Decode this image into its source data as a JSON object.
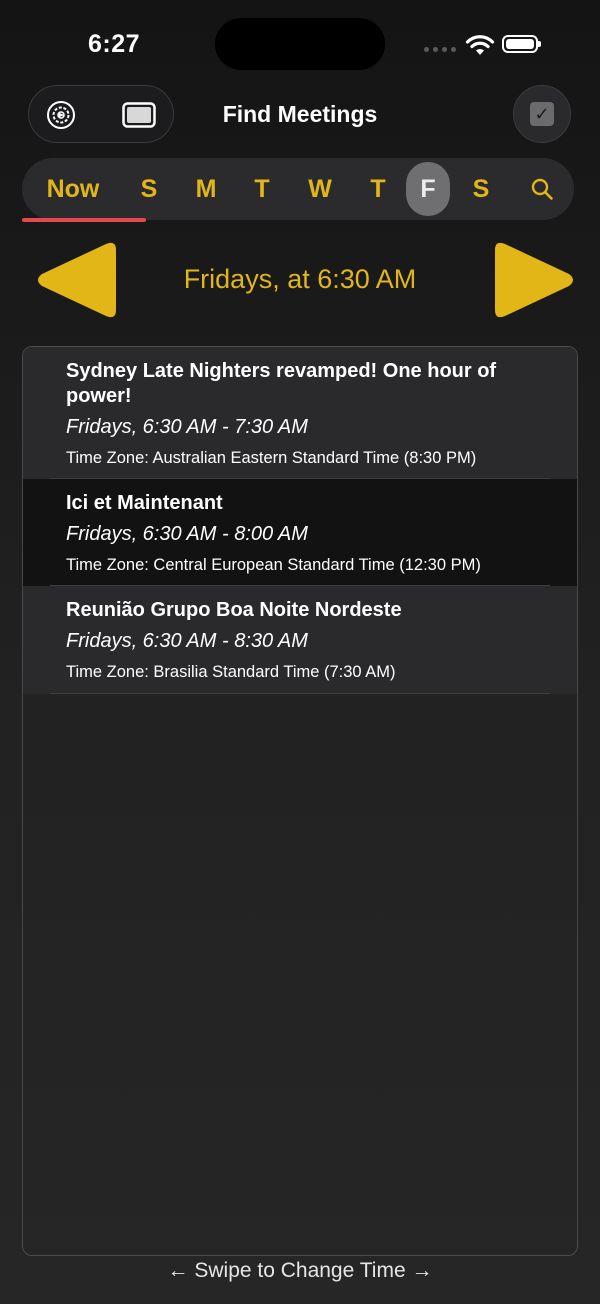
{
  "status_bar": {
    "time": "6:27"
  },
  "toolbar": {
    "title": "Find Meetings",
    "settings_icon": "settings-gear-icon",
    "window_icon": "window-icon",
    "checkbox_icon": "checkbox-checked-icon"
  },
  "days": {
    "now": "Now",
    "items": [
      "S",
      "M",
      "T",
      "W",
      "T",
      "F",
      "S"
    ],
    "selected": "F",
    "search_icon": "search-icon"
  },
  "time_nav": {
    "label": "Fridays, at 6:30 AM"
  },
  "meetings": [
    {
      "name": "Sydney Late Nighters revamped! One hour of power!",
      "when": "Fridays, 6:30 AM - 7:30 AM",
      "timezone": "Time Zone: Australian Eastern Standard Time (8:30 PM)"
    },
    {
      "name": "Ici et Maintenant",
      "when": "Fridays, 6:30 AM - 8:00 AM",
      "timezone": "Time Zone: Central European Standard Time (12:30 PM)"
    },
    {
      "name": "Reunião Grupo Boa Noite Nordeste",
      "when": "Fridays, 6:30 AM - 8:30 AM",
      "timezone": "Time Zone: Brasilia Standard Time (7:30 AM)"
    }
  ],
  "footer": {
    "hint": "← Swipe to Change Time →"
  },
  "colors": {
    "accent": "#e3b617",
    "underline": "#e5484d",
    "background": "#1c1c1c"
  }
}
